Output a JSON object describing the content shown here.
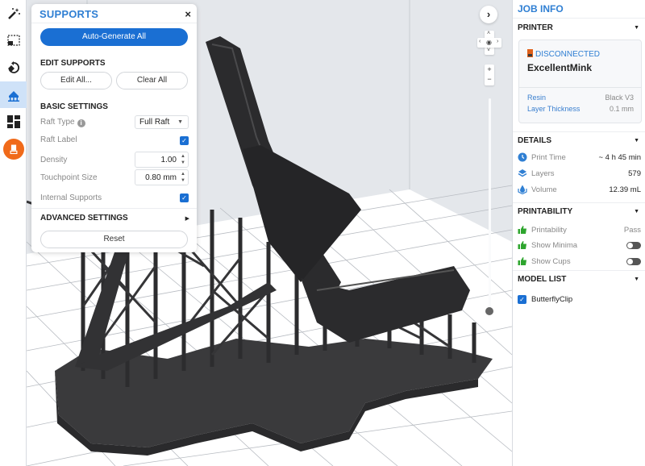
{
  "toolbar": {
    "tools": [
      {
        "name": "magic-wand-icon",
        "active": false
      },
      {
        "name": "select-box-icon",
        "active": false
      },
      {
        "name": "orient-icon",
        "active": false
      },
      {
        "name": "supports-icon",
        "active": true
      },
      {
        "name": "layout-icon",
        "active": false
      },
      {
        "name": "printer-upload-icon",
        "active": false
      }
    ]
  },
  "supports_panel": {
    "title": "SUPPORTS",
    "close": "×",
    "auto_generate_label": "Auto-Generate All",
    "edit_supports_title": "EDIT SUPPORTS",
    "edit_all_label": "Edit All...",
    "clear_all_label": "Clear All",
    "basic_settings_title": "BASIC SETTINGS",
    "raft_type_label": "Raft Type",
    "raft_type_value": "Full Raft",
    "raft_label_label": "Raft Label",
    "raft_label_checked": true,
    "density_label": "Density",
    "density_value": "1.00",
    "touchpoint_label": "Touchpoint Size",
    "touchpoint_value": "0.80 mm",
    "internal_supports_label": "Internal Supports",
    "internal_supports_checked": true,
    "advanced_settings_title": "ADVANCED SETTINGS",
    "reset_label": "Reset"
  },
  "view_controls": {
    "expand": "›",
    "up": "˄",
    "down": "˅",
    "left": "‹",
    "right": "›",
    "zoom_in": "+",
    "zoom_out": "−",
    "layer_slider_position": 1.0
  },
  "job_info": {
    "title": "JOB INFO",
    "printer": {
      "section": "PRINTER",
      "status": "DISCONNECTED",
      "name": "ExcellentMink",
      "resin_label": "Resin",
      "resin_value": "Black V3",
      "layer_thickness_label": "Layer Thickness",
      "layer_thickness_value": "0.1 mm"
    },
    "details": {
      "section": "DETAILS",
      "print_time_label": "Print Time",
      "print_time_value": "~ 4 h 45 min",
      "layers_label": "Layers",
      "layers_value": "579",
      "volume_label": "Volume",
      "volume_value": "12.39 mL"
    },
    "printability": {
      "section": "PRINTABILITY",
      "printability_label": "Printability",
      "printability_value": "Pass",
      "show_minima_label": "Show Minima",
      "show_minima_on": false,
      "show_cups_label": "Show Cups",
      "show_cups_on": false
    },
    "model_list": {
      "section": "MODEL LIST",
      "models": [
        {
          "name": "ButterflyClip",
          "checked": true
        }
      ]
    }
  },
  "colors": {
    "accent": "#1a6fd3",
    "title_blue": "#2f7fd3",
    "orange": "#f06a1a",
    "thumbs_green": "#2ea52e"
  }
}
